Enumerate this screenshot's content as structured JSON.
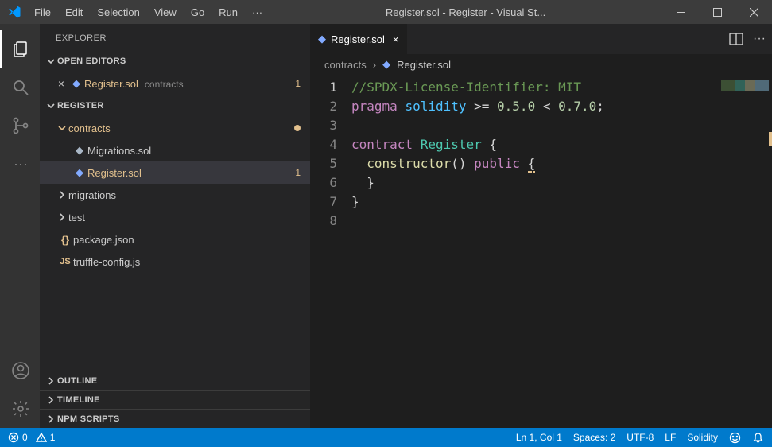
{
  "titlebar": {
    "title": "Register.sol - Register - Visual St...",
    "menus": [
      "File",
      "Edit",
      "Selection",
      "View",
      "Go",
      "Run"
    ],
    "overflow": "···"
  },
  "sidebar": {
    "title": "EXPLORER",
    "open_editors_label": "OPEN EDITORS",
    "open_editors": [
      {
        "name": "Register.sol",
        "hint": "contracts",
        "badge": "1"
      }
    ],
    "project_label": "REGISTER",
    "tree": {
      "contracts": {
        "label": "contracts",
        "modified": true,
        "children": [
          {
            "label": "Migrations.sol",
            "icon": "eth"
          },
          {
            "label": "Register.sol",
            "icon": "eth",
            "accent": true,
            "selected": true,
            "badge": "1"
          }
        ]
      },
      "migrations": {
        "label": "migrations"
      },
      "test": {
        "label": "test"
      },
      "files": [
        {
          "label": "package.json",
          "icon": "json"
        },
        {
          "label": "truffle-config.js",
          "icon": "js"
        }
      ]
    },
    "outline_label": "OUTLINE",
    "timeline_label": "TIMELINE",
    "npm_label": "NPM SCRIPTS"
  },
  "editor": {
    "tab_name": "Register.sol",
    "breadcrumb": [
      "contracts",
      "Register.sol"
    ],
    "lines": [
      {
        "n": 1,
        "html": "<span class='c-comment'>//SPDX-License-Identifier: MIT</span>"
      },
      {
        "n": 2,
        "html": "<span class='c-keyword'>pragma</span> <span class='c-id2'>solidity</span> &gt;= <span class='c-num'>0.5.0</span> &lt; <span class='c-num'>0.7.0</span>;"
      },
      {
        "n": 3,
        "html": ""
      },
      {
        "n": 4,
        "html": "<span class='c-keyword'>contract</span> <span class='c-type'>Register</span> {"
      },
      {
        "n": 5,
        "html": "  <span class='c-func'>constructor</span>() <span class='c-keyword'>public</span> <span style='border-bottom:2px dotted #e2c08d'>{</span>"
      },
      {
        "n": 6,
        "html": "  }"
      },
      {
        "n": 7,
        "html": "}"
      },
      {
        "n": 8,
        "html": ""
      }
    ]
  },
  "status": {
    "errors": "0",
    "warnings": "1",
    "cursor": "Ln 1, Col 1",
    "spaces": "Spaces: 2",
    "encoding": "UTF-8",
    "eol": "LF",
    "lang": "Solidity"
  }
}
